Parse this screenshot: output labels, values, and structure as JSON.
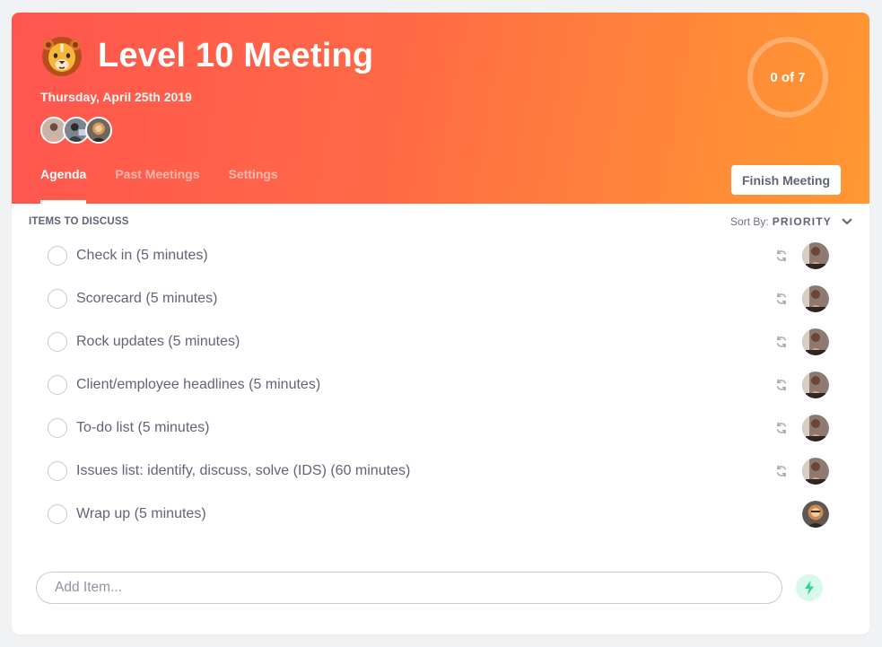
{
  "meeting": {
    "icon": "lion-emoji-icon",
    "title": "Level 10 Meeting",
    "date": "Thursday, April 25th 2019",
    "attendees": [
      {
        "name": "attendee-1",
        "color": "#b89488"
      },
      {
        "name": "attendee-2",
        "color": "#5c5f66"
      },
      {
        "name": "attendee-3",
        "color": "#a6744e"
      }
    ],
    "progress": {
      "completed": 0,
      "total": 7,
      "text": "0 of 7"
    }
  },
  "tabs": [
    {
      "label": "Agenda",
      "active": true
    },
    {
      "label": "Past Meetings",
      "active": false
    },
    {
      "label": "Settings",
      "active": false
    }
  ],
  "actions": {
    "finish_label": "Finish Meeting"
  },
  "agenda": {
    "section_title": "ITEMS TO DISCUSS",
    "sort_label": "Sort By:",
    "sort_value": "PRIORITY",
    "items": [
      {
        "label": "Check in (5 minutes)",
        "recurring": true,
        "owner": "owner-a"
      },
      {
        "label": "Scorecard (5 minutes)",
        "recurring": true,
        "owner": "owner-a"
      },
      {
        "label": "Rock updates (5 minutes)",
        "recurring": true,
        "owner": "owner-a"
      },
      {
        "label": "Client/employee headlines (5 minutes)",
        "recurring": true,
        "owner": "owner-a"
      },
      {
        "label": "To-do list (5 minutes)",
        "recurring": true,
        "owner": "owner-a"
      },
      {
        "label": "Issues list: identify, discuss, solve (IDS) (60 minutes)",
        "recurring": true,
        "owner": "owner-a"
      },
      {
        "label": "Wrap up (5 minutes)",
        "recurring": false,
        "owner": "owner-b"
      }
    ]
  },
  "add_item": {
    "placeholder": "Add Item...",
    "value": ""
  },
  "colors": {
    "header_start": "#ff5550",
    "header_end": "#ff9832",
    "bolt_bg": "#d7f8ea",
    "bolt": "#2fd38e"
  }
}
